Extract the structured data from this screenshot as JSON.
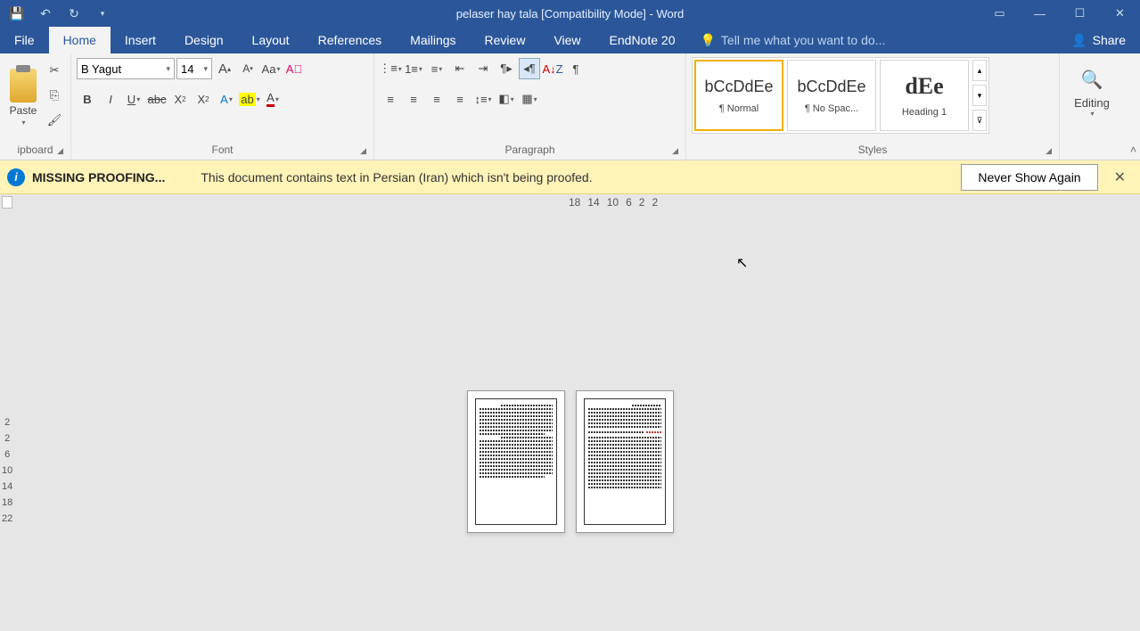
{
  "titlebar": {
    "title": "pelaser hay tala [Compatibility Mode] - Word"
  },
  "tabs": {
    "file": "File",
    "home": "Home",
    "insert": "Insert",
    "design": "Design",
    "layout": "Layout",
    "references": "References",
    "mailings": "Mailings",
    "review": "Review",
    "view": "View",
    "endnote": "EndNote 20",
    "tellme": "Tell me what you want to do...",
    "share": "Share"
  },
  "ribbon": {
    "clipboard": {
      "paste": "Paste",
      "label": "ipboard"
    },
    "font": {
      "name": "B Yagut",
      "size": "14",
      "label": "Font"
    },
    "paragraph": {
      "label": "Paragraph"
    },
    "styles": {
      "label": "Styles",
      "items": [
        {
          "preview": "bCcDdEe",
          "name": "¶ Normal"
        },
        {
          "preview": "bCcDdEe",
          "name": "¶ No Spac..."
        },
        {
          "preview": "dEe",
          "name": "Heading 1"
        }
      ]
    },
    "editing": {
      "label": "Editing"
    }
  },
  "proofing": {
    "title": "MISSING PROOFING...",
    "message": "This document contains text in Persian (Iran) which isn't being proofed.",
    "button": "Never Show Again"
  },
  "ruler": {
    "h": [
      "18",
      "14",
      "10",
      "6",
      "2",
      "2"
    ],
    "v": [
      "2",
      "2",
      "6",
      "10",
      "14",
      "18",
      "22"
    ]
  }
}
